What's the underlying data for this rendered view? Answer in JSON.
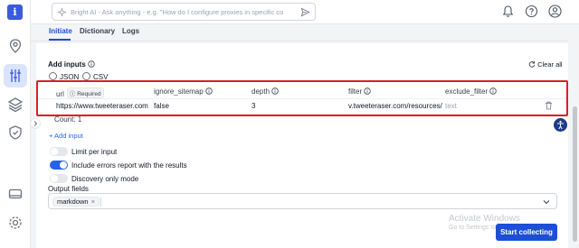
{
  "logo": {
    "letter": "i"
  },
  "search": {
    "text": "Bright AI - Ask anything - e.g. \"How do I configure proxies in specific co"
  },
  "tabs": [
    {
      "label": "Initiate",
      "active": true
    },
    {
      "label": "Dictionary",
      "active": false
    },
    {
      "label": "Logs",
      "active": false
    }
  ],
  "inputs": {
    "title": "Add inputs",
    "clear_all": "Clear all",
    "formats": [
      "JSON",
      "CSV"
    ],
    "columns": [
      {
        "key": "url",
        "label": "url",
        "badge": "Required"
      },
      {
        "key": "ignore_sitemap",
        "label": "ignore_sitemap"
      },
      {
        "key": "depth",
        "label": "depth"
      },
      {
        "key": "filter",
        "label": "filter"
      },
      {
        "key": "exclude_filter",
        "label": "exclude_filter"
      }
    ],
    "row": {
      "url": "https://www.tweeteraser.com",
      "ignore_sitemap": "false",
      "depth": "3",
      "filter": "v.tweeteraser.com/resources/",
      "exclude_filter": "text"
    },
    "count": "Count: 1",
    "add_input": "+ Add input"
  },
  "options": [
    {
      "label": "Limit per input",
      "enabled": false
    },
    {
      "label": "Include errors report with the results",
      "enabled": true
    },
    {
      "label": "Discovery only mode",
      "enabled": false
    }
  ],
  "output": {
    "label": "Output fields",
    "chips": [
      "markdown"
    ]
  },
  "watermark": {
    "line1": "Activate Windows",
    "line2": "Go to Settings to activate Windows."
  },
  "start_button": "Start collecting",
  "colors": {
    "accent": "#1d4ed8",
    "highlight": "#d91e2a"
  }
}
